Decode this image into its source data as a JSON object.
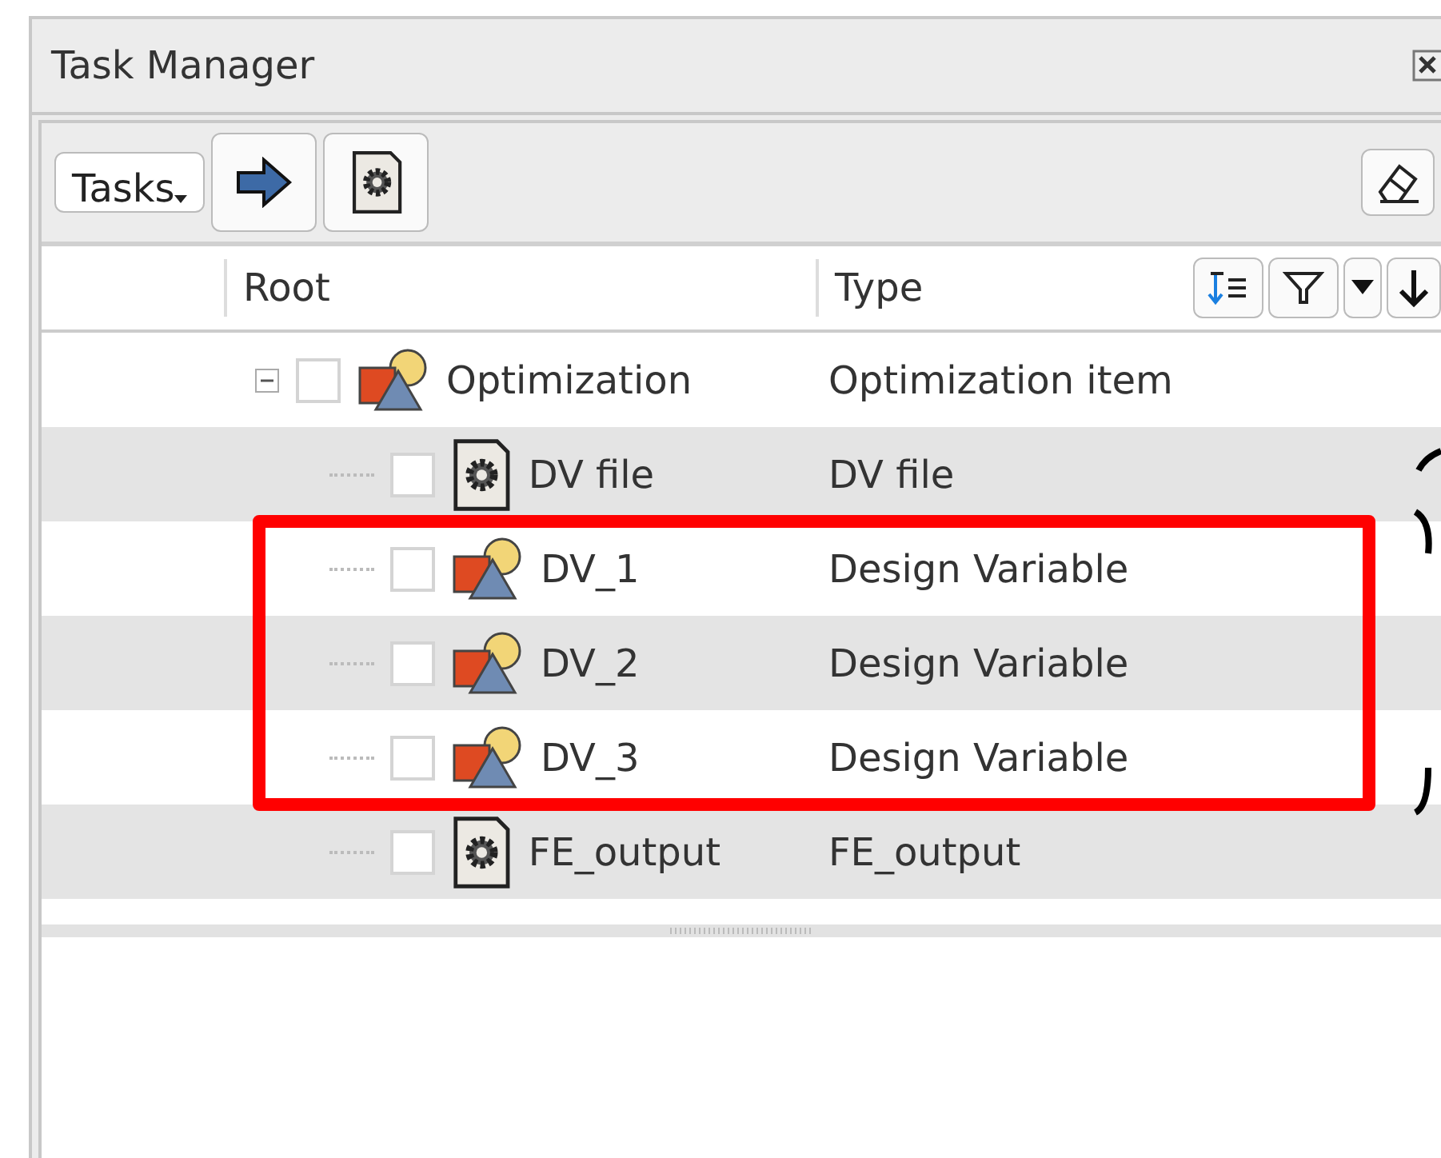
{
  "window": {
    "title": "Task Manager"
  },
  "toolbar": {
    "dropdown": "Tasks"
  },
  "columns": [
    "Root",
    "Type"
  ],
  "tree": [
    {
      "name": "Optimization",
      "type": "Optimization item",
      "kind": "group",
      "checked": false,
      "expanded": true,
      "highlighted": false,
      "children": [
        {
          "name": "DV file",
          "type": "DV file",
          "kind": "file",
          "checked": false,
          "highlighted": false
        },
        {
          "name": "DV_1",
          "type": "Design Variable",
          "kind": "group",
          "checked": false,
          "highlighted": true
        },
        {
          "name": "DV_2",
          "type": "Design Variable",
          "kind": "group",
          "checked": false,
          "highlighted": true
        },
        {
          "name": "DV_3",
          "type": "Design Variable",
          "kind": "group",
          "checked": false,
          "highlighted": true
        },
        {
          "name": "FE_output",
          "type": "FE_output",
          "kind": "file",
          "checked": false,
          "highlighted": false
        }
      ]
    }
  ]
}
